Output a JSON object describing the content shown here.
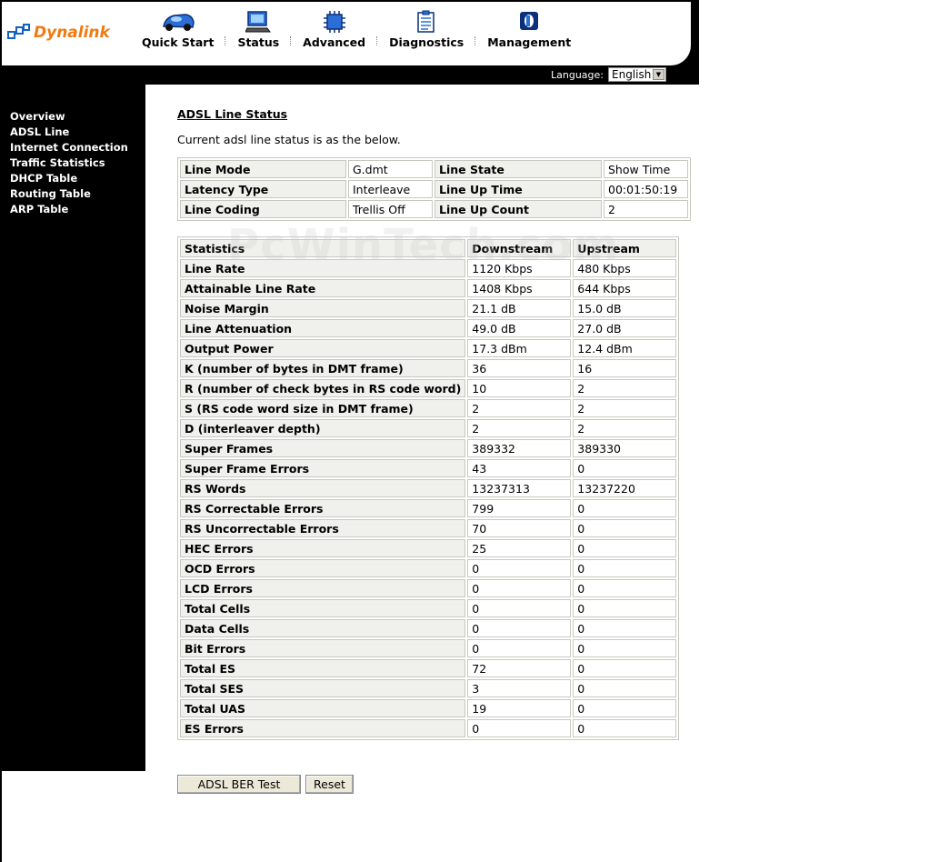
{
  "brand": {
    "name": "Dynalink"
  },
  "nav": [
    {
      "label": "Quick Start",
      "icon": "car-icon"
    },
    {
      "label": "Status",
      "icon": "monitor-icon"
    },
    {
      "label": "Advanced",
      "icon": "chip-icon"
    },
    {
      "label": "Diagnostics",
      "icon": "clipboard-icon"
    },
    {
      "label": "Management",
      "icon": "management-icon"
    }
  ],
  "language": {
    "label": "Language:",
    "selected": "English"
  },
  "sidebar": {
    "items": [
      "Overview",
      "ADSL Line",
      "Internet Connection",
      "Traffic Statistics",
      "DHCP Table",
      "Routing Table",
      "ARP Table"
    ]
  },
  "main": {
    "title": "ADSL Line Status",
    "description": "Current adsl line status is as the below.",
    "watermark": "PcWinTech.com",
    "line_info": [
      [
        "Line Mode",
        "G.dmt",
        "Line State",
        "Show Time"
      ],
      [
        "Latency Type",
        "Interleave",
        "Line Up Time",
        "00:01:50:19"
      ],
      [
        "Line Coding",
        "Trellis Off",
        "Line Up Count",
        "2"
      ]
    ],
    "stats_header": [
      "Statistics",
      "Downstream",
      "Upstream"
    ],
    "stats": [
      [
        "Line Rate",
        "1120 Kbps",
        "480 Kbps"
      ],
      [
        "Attainable Line Rate",
        "1408 Kbps",
        "644 Kbps"
      ],
      [
        "Noise Margin",
        "21.1 dB",
        "15.0 dB"
      ],
      [
        "Line Attenuation",
        "49.0 dB",
        "27.0 dB"
      ],
      [
        "Output Power",
        "17.3 dBm",
        "12.4 dBm"
      ],
      [
        "K (number of bytes in DMT frame)",
        "36",
        "16"
      ],
      [
        "R (number of check bytes in RS code word)",
        "10",
        "2"
      ],
      [
        "S (RS code word size in DMT frame)",
        "2",
        "2"
      ],
      [
        "D (interleaver depth)",
        "2",
        "2"
      ],
      [
        "Super Frames",
        "389332",
        "389330"
      ],
      [
        "Super Frame Errors",
        "43",
        "0"
      ],
      [
        "RS Words",
        "13237313",
        "13237220"
      ],
      [
        "RS Correctable Errors",
        "799",
        "0"
      ],
      [
        "RS Uncorrectable Errors",
        "70",
        "0"
      ],
      [
        "HEC Errors",
        "25",
        "0"
      ],
      [
        "OCD Errors",
        "0",
        "0"
      ],
      [
        "LCD Errors",
        "0",
        "0"
      ],
      [
        "Total Cells",
        "0",
        "0"
      ],
      [
        "Data Cells",
        "0",
        "0"
      ],
      [
        "Bit Errors",
        "0",
        "0"
      ],
      [
        "Total ES",
        "72",
        "0"
      ],
      [
        "Total SES",
        "3",
        "0"
      ],
      [
        "Total UAS",
        "19",
        "0"
      ],
      [
        "ES Errors",
        "0",
        "0"
      ]
    ],
    "buttons": {
      "ber_test": "ADSL BER Test",
      "reset": "Reset"
    }
  },
  "colors": {
    "brand_orange": "#f07a10",
    "brand_blue": "#1560bd",
    "frame": "#000000",
    "header_cell": "#f0f0ec"
  }
}
